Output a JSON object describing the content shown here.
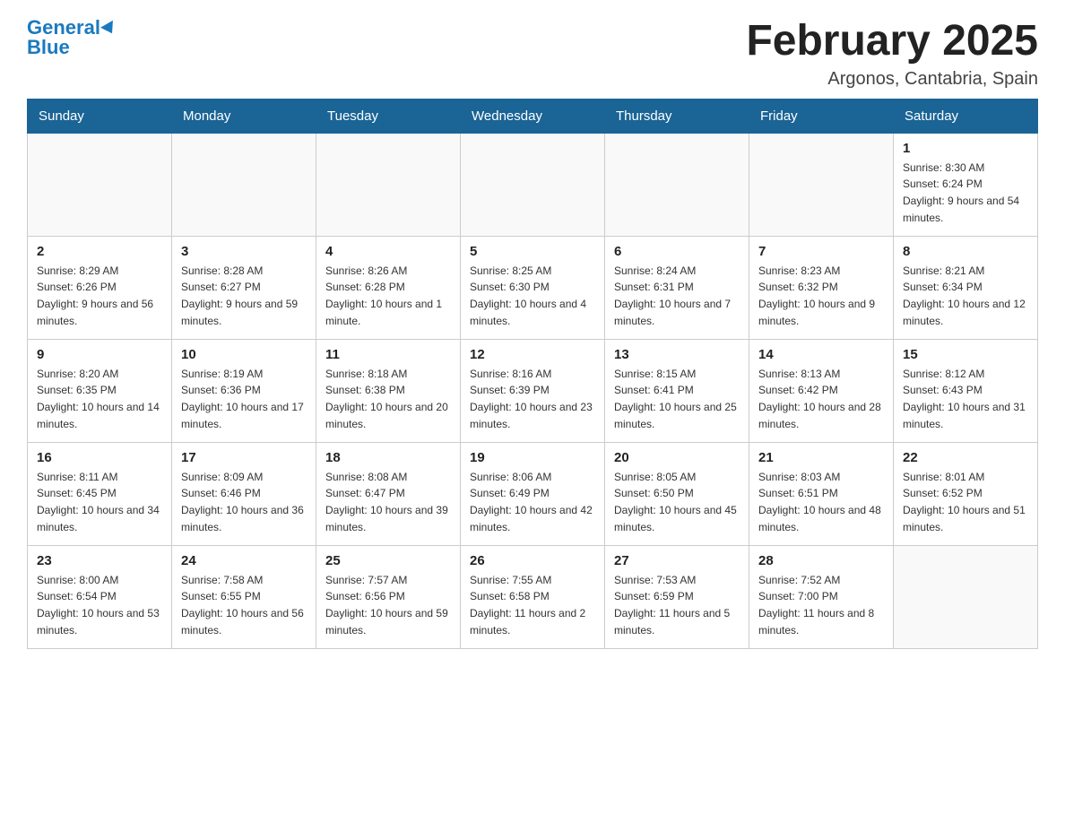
{
  "header": {
    "logo_general": "General",
    "logo_blue": "Blue",
    "month_title": "February 2025",
    "location": "Argonos, Cantabria, Spain"
  },
  "days_of_week": [
    "Sunday",
    "Monday",
    "Tuesday",
    "Wednesday",
    "Thursday",
    "Friday",
    "Saturday"
  ],
  "weeks": [
    [
      {
        "day": "",
        "info": ""
      },
      {
        "day": "",
        "info": ""
      },
      {
        "day": "",
        "info": ""
      },
      {
        "day": "",
        "info": ""
      },
      {
        "day": "",
        "info": ""
      },
      {
        "day": "",
        "info": ""
      },
      {
        "day": "1",
        "info": "Sunrise: 8:30 AM\nSunset: 6:24 PM\nDaylight: 9 hours and 54 minutes."
      }
    ],
    [
      {
        "day": "2",
        "info": "Sunrise: 8:29 AM\nSunset: 6:26 PM\nDaylight: 9 hours and 56 minutes."
      },
      {
        "day": "3",
        "info": "Sunrise: 8:28 AM\nSunset: 6:27 PM\nDaylight: 9 hours and 59 minutes."
      },
      {
        "day": "4",
        "info": "Sunrise: 8:26 AM\nSunset: 6:28 PM\nDaylight: 10 hours and 1 minute."
      },
      {
        "day": "5",
        "info": "Sunrise: 8:25 AM\nSunset: 6:30 PM\nDaylight: 10 hours and 4 minutes."
      },
      {
        "day": "6",
        "info": "Sunrise: 8:24 AM\nSunset: 6:31 PM\nDaylight: 10 hours and 7 minutes."
      },
      {
        "day": "7",
        "info": "Sunrise: 8:23 AM\nSunset: 6:32 PM\nDaylight: 10 hours and 9 minutes."
      },
      {
        "day": "8",
        "info": "Sunrise: 8:21 AM\nSunset: 6:34 PM\nDaylight: 10 hours and 12 minutes."
      }
    ],
    [
      {
        "day": "9",
        "info": "Sunrise: 8:20 AM\nSunset: 6:35 PM\nDaylight: 10 hours and 14 minutes."
      },
      {
        "day": "10",
        "info": "Sunrise: 8:19 AM\nSunset: 6:36 PM\nDaylight: 10 hours and 17 minutes."
      },
      {
        "day": "11",
        "info": "Sunrise: 8:18 AM\nSunset: 6:38 PM\nDaylight: 10 hours and 20 minutes."
      },
      {
        "day": "12",
        "info": "Sunrise: 8:16 AM\nSunset: 6:39 PM\nDaylight: 10 hours and 23 minutes."
      },
      {
        "day": "13",
        "info": "Sunrise: 8:15 AM\nSunset: 6:41 PM\nDaylight: 10 hours and 25 minutes."
      },
      {
        "day": "14",
        "info": "Sunrise: 8:13 AM\nSunset: 6:42 PM\nDaylight: 10 hours and 28 minutes."
      },
      {
        "day": "15",
        "info": "Sunrise: 8:12 AM\nSunset: 6:43 PM\nDaylight: 10 hours and 31 minutes."
      }
    ],
    [
      {
        "day": "16",
        "info": "Sunrise: 8:11 AM\nSunset: 6:45 PM\nDaylight: 10 hours and 34 minutes."
      },
      {
        "day": "17",
        "info": "Sunrise: 8:09 AM\nSunset: 6:46 PM\nDaylight: 10 hours and 36 minutes."
      },
      {
        "day": "18",
        "info": "Sunrise: 8:08 AM\nSunset: 6:47 PM\nDaylight: 10 hours and 39 minutes."
      },
      {
        "day": "19",
        "info": "Sunrise: 8:06 AM\nSunset: 6:49 PM\nDaylight: 10 hours and 42 minutes."
      },
      {
        "day": "20",
        "info": "Sunrise: 8:05 AM\nSunset: 6:50 PM\nDaylight: 10 hours and 45 minutes."
      },
      {
        "day": "21",
        "info": "Sunrise: 8:03 AM\nSunset: 6:51 PM\nDaylight: 10 hours and 48 minutes."
      },
      {
        "day": "22",
        "info": "Sunrise: 8:01 AM\nSunset: 6:52 PM\nDaylight: 10 hours and 51 minutes."
      }
    ],
    [
      {
        "day": "23",
        "info": "Sunrise: 8:00 AM\nSunset: 6:54 PM\nDaylight: 10 hours and 53 minutes."
      },
      {
        "day": "24",
        "info": "Sunrise: 7:58 AM\nSunset: 6:55 PM\nDaylight: 10 hours and 56 minutes."
      },
      {
        "day": "25",
        "info": "Sunrise: 7:57 AM\nSunset: 6:56 PM\nDaylight: 10 hours and 59 minutes."
      },
      {
        "day": "26",
        "info": "Sunrise: 7:55 AM\nSunset: 6:58 PM\nDaylight: 11 hours and 2 minutes."
      },
      {
        "day": "27",
        "info": "Sunrise: 7:53 AM\nSunset: 6:59 PM\nDaylight: 11 hours and 5 minutes."
      },
      {
        "day": "28",
        "info": "Sunrise: 7:52 AM\nSunset: 7:00 PM\nDaylight: 11 hours and 8 minutes."
      },
      {
        "day": "",
        "info": ""
      }
    ]
  ]
}
